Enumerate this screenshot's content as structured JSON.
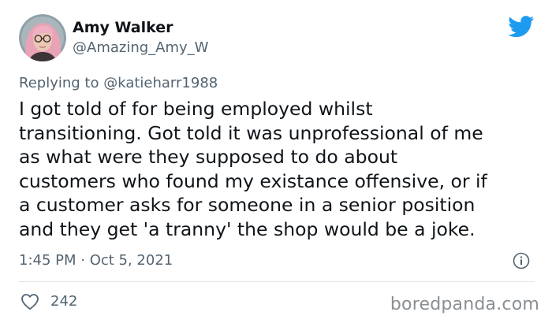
{
  "author": {
    "display_name": "Amy Walker",
    "handle": "@Amazing_Amy_W"
  },
  "reply": {
    "prefix": "Replying to",
    "mention": "@katieharr1988"
  },
  "tweet": {
    "lines": [
      "I got told of for being employed whilst",
      "transitioning. Got told it was unprofessional of me",
      "as what were they supposed to do about",
      "customers who found my existance offensive, or if",
      "a customer asks for someone in a senior position",
      "and they get 'a tranny' the shop would be a joke."
    ],
    "timestamp": "1:45 PM · Oct 5, 2021",
    "likes": "242"
  },
  "watermark": "boredpanda.com",
  "icons": {
    "brand": "twitter-bird-icon",
    "info": "info-icon",
    "like": "heart-icon"
  },
  "colors": {
    "twitter_blue": "#1d9bf0",
    "text_primary": "#0f1419",
    "text_secondary": "#536471",
    "divider": "#e1e6ea"
  }
}
